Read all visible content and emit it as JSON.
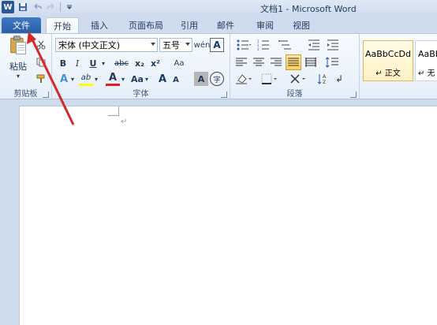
{
  "window": {
    "title": "文档1 - Microsoft Word",
    "logo": "W"
  },
  "qat": [
    {
      "name": "save-icon",
      "glyph": "💾"
    },
    {
      "name": "undo-icon",
      "glyph": "↶"
    },
    {
      "name": "redo-icon",
      "glyph": "↷"
    },
    {
      "name": "customize-qat-icon",
      "glyph": "▾"
    }
  ],
  "tabs": {
    "file": "文件",
    "items": [
      "开始",
      "插入",
      "页面布局",
      "引用",
      "邮件",
      "审阅",
      "视图"
    ],
    "active_index": 0
  },
  "clipboard": {
    "paste": "粘贴",
    "label": "剪贴板"
  },
  "font": {
    "name": "宋体 (中文正文)",
    "size": "五号",
    "label": "字体",
    "row1": {
      "grow": "A",
      "shrink": "A",
      "clear": "A"
    },
    "row2": {
      "bold": "B",
      "italic": "I",
      "underline": "U",
      "strike": "abc",
      "sub": "x₂",
      "sup": "x²",
      "change_case": "Aa"
    },
    "row3": {
      "text_effect": "A",
      "highlight": "ab",
      "font_color": "A",
      "case": "Aa",
      "grow": "A",
      "shrink": "A",
      "char_shade": "A",
      "enclose": "字"
    }
  },
  "paragraph": {
    "label": "段落"
  },
  "styles": [
    {
      "sample": "AaBbCcDd",
      "name": "↵ 正文",
      "selected": true
    },
    {
      "sample": "AaBb",
      "name": "↵ 无",
      "selected": false
    }
  ],
  "colors": {
    "file_tab": "#2b5ea6",
    "arrow": "#d42a2a",
    "highlight": "#ffff00",
    "font_color": "#e02020"
  }
}
